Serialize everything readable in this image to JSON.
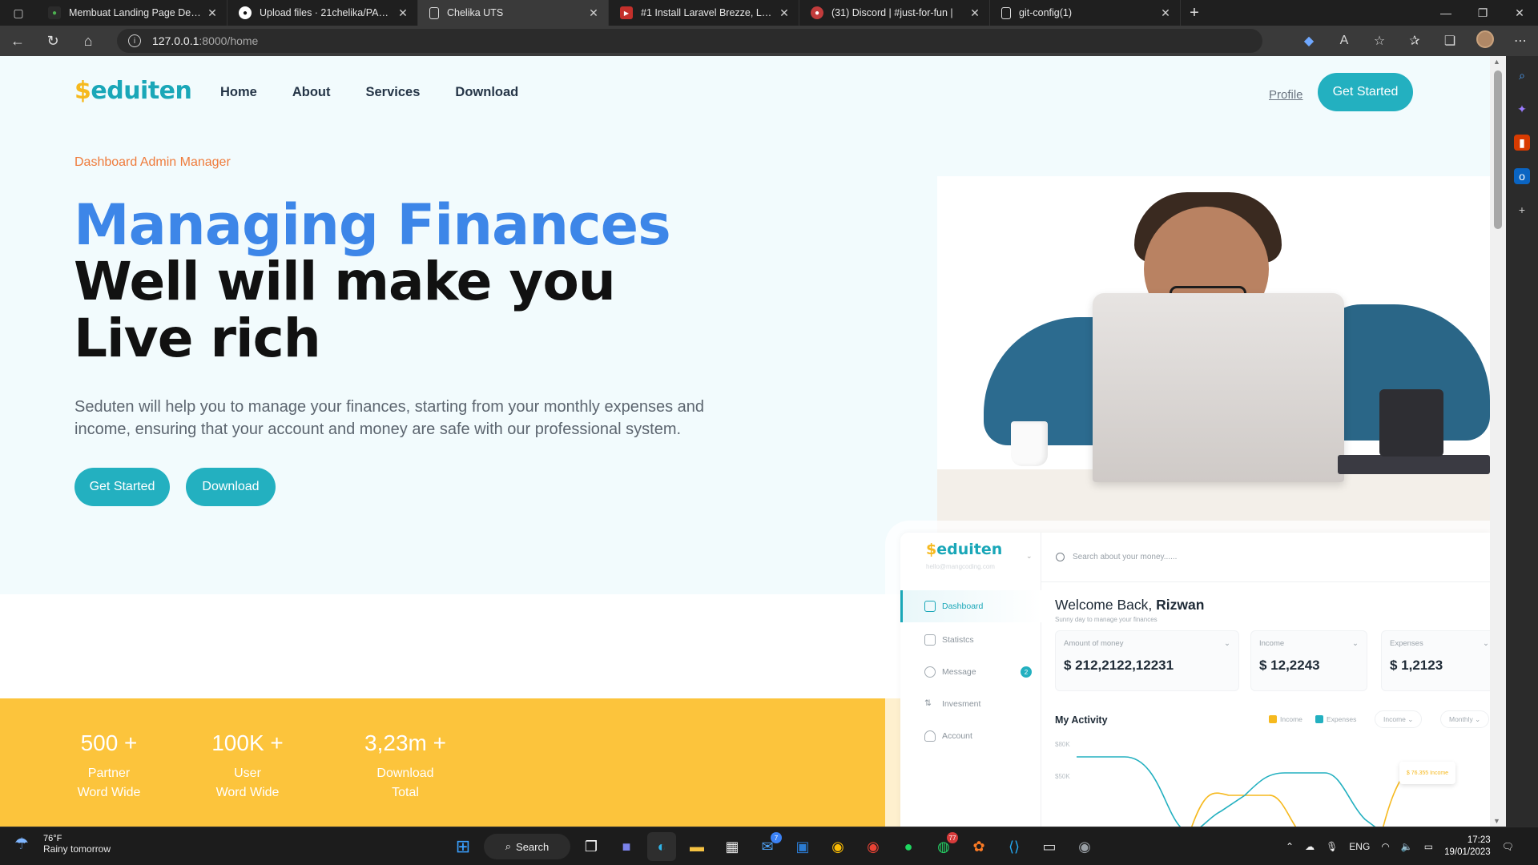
{
  "browser": {
    "tabs": [
      {
        "title": "Membuat Landing Page Dengan",
        "favicon_color": "#2b2b2b",
        "favicon": "green-dot",
        "active": false
      },
      {
        "title": "Upload files · 21chelika/PABW-C",
        "favicon_color": "#ffffff",
        "favicon": "github-icon",
        "active": false
      },
      {
        "title": "Chelika UTS",
        "favicon_color": "#3a3a3a",
        "favicon": "page-icon",
        "active": true
      },
      {
        "title": "#1 Install Laravel Brezze, Login, d",
        "favicon_color": "#c4302b",
        "favicon": "youtube-icon",
        "active": false
      },
      {
        "title": "(31) Discord | #just-for-fun |",
        "favicon_color": "#5865f2",
        "favicon": "discord-icon",
        "active": false
      },
      {
        "title": "git-config(1)",
        "favicon_color": "#3a3a3a",
        "favicon": "page-icon",
        "active": false
      }
    ],
    "address": {
      "host": "127.0.0.1",
      "path": ":8000/home"
    }
  },
  "page": {
    "logo": {
      "dollar": "$",
      "name": "eduiten"
    },
    "nav": [
      "Home",
      "About",
      "Services",
      "Download"
    ],
    "profile": "Profile",
    "cta": "Get Started",
    "hero": {
      "kicker": "Dashboard Admin Manager",
      "title_blue": "Managing Finances",
      "title_black": "Well will make you Live rich",
      "lead": "Seduten will help you to manage your finances, starting from your monthly expenses and income, ensuring that your account and money are safe with our professional system.",
      "btn_primary": "Get Started",
      "btn_secondary": "Download"
    },
    "stats": [
      {
        "value": "500 +",
        "line1": "Partner",
        "line2": "Word Wide"
      },
      {
        "value": "100K +",
        "line1": "User",
        "line2": "Word Wide"
      },
      {
        "value": "3,23m +",
        "line1": "Download",
        "line2": "Total"
      }
    ],
    "colors": {
      "teal": "#23b0c0",
      "blue": "#3d86e8",
      "orange": "#ef7b3b",
      "yellow": "#fcc43c"
    }
  },
  "dashboard": {
    "logo": {
      "dollar": "$",
      "name": "eduiten"
    },
    "email": "hello@mangcoding.com",
    "search_placeholder": "Search about your money......",
    "menu": [
      "Dashboard",
      "Statistcs",
      "Message",
      "Invesment",
      "Account"
    ],
    "message_badge": "2",
    "welcome": "Welcome Back,",
    "user": "Rizwan",
    "subtitle": "Sunny day to manage your finances",
    "cards": [
      {
        "label": "Amount of money",
        "value": "$ 212,2122,12231"
      },
      {
        "label": "Income",
        "value": "$ 12,2243"
      },
      {
        "label": "Expenses",
        "value": "$ 1,2123"
      }
    ],
    "activity_title": "My Activity",
    "legend": [
      "Income",
      "Expenses"
    ],
    "filter_type": "Income",
    "filter_period": "Monthly",
    "tooltip": "$ 76.355 Income",
    "chart_data": {
      "type": "line",
      "y_ticks": [
        "$80K",
        "$50K"
      ],
      "series": [
        {
          "name": "Income",
          "color": "#f6b91e"
        },
        {
          "name": "Expenses",
          "color": "#23b0c0"
        }
      ]
    }
  },
  "taskbar": {
    "weather_temp": "76°F",
    "weather_text": "Rainy tomorrow",
    "search": "Search",
    "mail_badge": "7",
    "whatsapp_badge": "77",
    "language": "ENG",
    "time": "17:23",
    "date": "19/01/2023"
  }
}
